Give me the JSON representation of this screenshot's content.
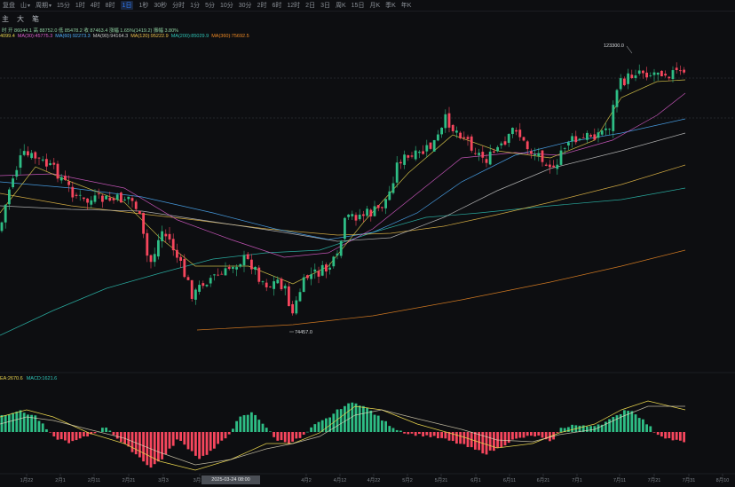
{
  "toolbar": {
    "items": [
      {
        "label": "复盘",
        "chevron": false,
        "active": false
      },
      {
        "label": "山",
        "chevron": true,
        "active": false
      },
      {
        "label": "周期",
        "chevron": true,
        "active": false
      },
      {
        "label": "15分",
        "chevron": false,
        "active": false
      },
      {
        "label": "1时",
        "chevron": false,
        "active": false
      },
      {
        "label": "4时",
        "chevron": false,
        "active": false
      },
      {
        "label": "8时",
        "chevron": false,
        "active": false
      },
      {
        "label": "1日",
        "chevron": false,
        "active": true
      },
      {
        "label": "1秒",
        "chevron": false,
        "active": false
      },
      {
        "label": "30秒",
        "chevron": false,
        "active": false
      },
      {
        "label": "分时",
        "chevron": false,
        "active": false
      },
      {
        "label": "1分",
        "chevron": false,
        "active": false
      },
      {
        "label": "5分",
        "chevron": false,
        "active": false
      },
      {
        "label": "10分",
        "chevron": false,
        "active": false
      },
      {
        "label": "30分",
        "chevron": false,
        "active": false
      },
      {
        "label": "2时",
        "chevron": false,
        "active": false
      },
      {
        "label": "6时",
        "chevron": false,
        "active": false
      },
      {
        "label": "12时",
        "chevron": false,
        "active": false
      },
      {
        "label": "2日",
        "chevron": false,
        "active": false
      },
      {
        "label": "3日",
        "chevron": false,
        "active": false
      },
      {
        "label": "周K",
        "chevron": false,
        "active": false
      },
      {
        "label": "15日",
        "chevron": false,
        "active": false
      },
      {
        "label": "月K",
        "chevron": false,
        "active": false
      },
      {
        "label": "季K",
        "chevron": false,
        "active": false
      },
      {
        "label": "年K",
        "chevron": false,
        "active": false
      }
    ],
    "tools": [
      {
        "name": "indicator",
        "glyph": "主"
      },
      {
        "name": "zoom",
        "glyph": "大"
      },
      {
        "name": "draw",
        "glyph": "笔"
      }
    ]
  },
  "ohlc_line": "时 开 86044.1 高 88752.0 低 85478.2 收 87463.4 涨幅 1.65%(1419.2) 振幅 3.80%",
  "ma_legend": [
    {
      "text": "4099.4",
      "color": "#e8d44d"
    },
    {
      "text": "MA(30):45775.3",
      "color": "#e05fd0"
    },
    {
      "text": "MA(60):92273.3",
      "color": "#4fb0ff"
    },
    {
      "text": "MA(90):94164.3",
      "color": "#c9c9c9"
    },
    {
      "text": "MA(120):95222.9",
      "color": "#f0c24a"
    },
    {
      "text": "MA(200):85029.9",
      "color": "#2ec4b6"
    },
    {
      "text": "MA(360):75692.5",
      "color": "#f08a24"
    }
  ],
  "macd_legend": [
    {
      "text": "EA:2670.6",
      "color": "#e8d44d"
    },
    {
      "text": "MACD:1621.6",
      "color": "#2ec4b6"
    }
  ],
  "price_labels": {
    "high": "123300.0",
    "low": "74457.0"
  },
  "chart_data": {
    "type": "candlestick",
    "x_ticks": [
      "1月22",
      "2月1",
      "2月11",
      "2月21",
      "3月3",
      "3月13",
      "4月2",
      "4月12",
      "4月22",
      "5月2",
      "5月21",
      "6月1",
      "6月11",
      "6月21",
      "7月1",
      "7月11",
      "7月21",
      "7月31",
      "8月10"
    ],
    "highlighted_x_label": "2025-03-24 08:00",
    "max_high": 123300.0,
    "min_low": 74457.0,
    "up_color": "#2ebd85",
    "down_color": "#f6465d",
    "ma_colors": [
      "#e8d44d",
      "#e05fd0",
      "#4fb0ff",
      "#c9c9c9",
      "#f0c24a",
      "#2ec4b6",
      "#f08a24"
    ],
    "dif_color": "#e8d44d",
    "dea_color": "#e8e0c0"
  }
}
